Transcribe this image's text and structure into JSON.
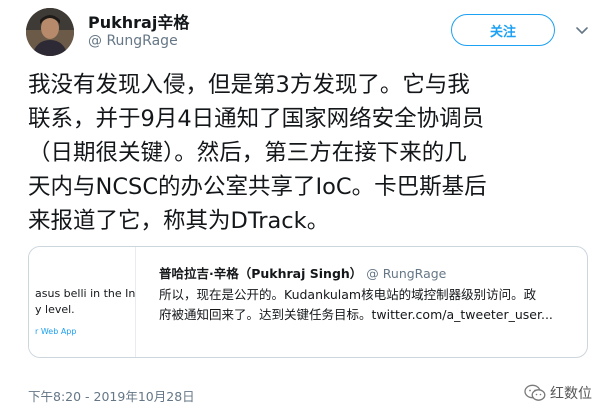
{
  "user": {
    "display_name": "Pukhraj辛格",
    "handle": "@ RungRage"
  },
  "follow_button": {
    "label": "关注"
  },
  "tweet": {
    "lines": [
      "我没有发现入侵，但是第3方发现了。它与我",
      "联系，并于9月4日通知了国家网络安全协调员",
      "（日期很关键）。然后，第三方在接下来的几",
      "天内与NCSC的办公室共享了IoC。卡巴斯基后",
      "来报道了它，称其为DTrack。"
    ]
  },
  "quote": {
    "name": "普哈拉吉·辛格（Pukhraj Singh）",
    "handle": "@ RungRage",
    "lines": [
      "所以，现在是公开的。Kudankulam核电站的域控制器级别访问。政",
      "府被通知回来了。达到关键任务目标。twitter.com/a_tweeter_user..."
    ],
    "image_text": {
      "line1": "asus belli in the Ind",
      "line2": "y level.",
      "source": "r Web App"
    }
  },
  "timestamp": "下午8:20 - 2019年10月28日",
  "watermark": {
    "label": "红数位"
  },
  "icons": {
    "menu": "chevron-down-icon",
    "watermark": "wechat-icon"
  },
  "colors": {
    "accent": "#1da1f2",
    "secondary_text": "#657786",
    "primary_text": "#14171a",
    "border": "#ccd6dd"
  }
}
